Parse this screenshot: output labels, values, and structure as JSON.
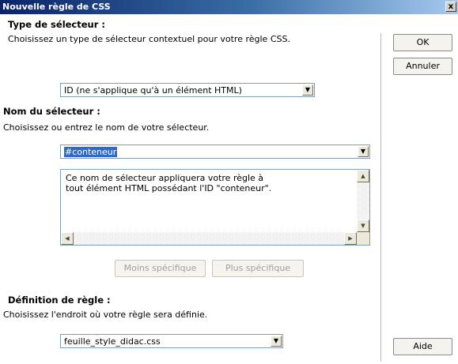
{
  "dialog": {
    "title": "Nouvelle règle de CSS",
    "close_label": "x"
  },
  "selector_type": {
    "heading": "Type de sélecteur :",
    "description": "Choisissez un type de sélecteur contextuel pour votre règle CSS.",
    "selected_value": "ID (ne s'applique qu'à un élément HTML)"
  },
  "selector_name": {
    "heading": "Nom du sélecteur :",
    "description": "Choisissez ou entrez le nom de votre sélecteur.",
    "input_value": "#conteneur",
    "info_line1": "Ce nom de sélecteur appliquera votre règle à",
    "info_line2": "tout élément HTML possédant l'ID \"conteneur\".",
    "less_specific_label": "Moins spécifique",
    "more_specific_label": "Plus spécifique"
  },
  "rule_definition": {
    "heading": "Définition de règle :",
    "description": "Choisissez l'endroit où votre règle sera définie.",
    "selected_value": "feuille_style_didac.css"
  },
  "buttons": {
    "ok": "OK",
    "cancel": "Annuler",
    "help": "Aide"
  },
  "colors": {
    "title_bar": "#0a246a",
    "selection": "#316ac5"
  }
}
